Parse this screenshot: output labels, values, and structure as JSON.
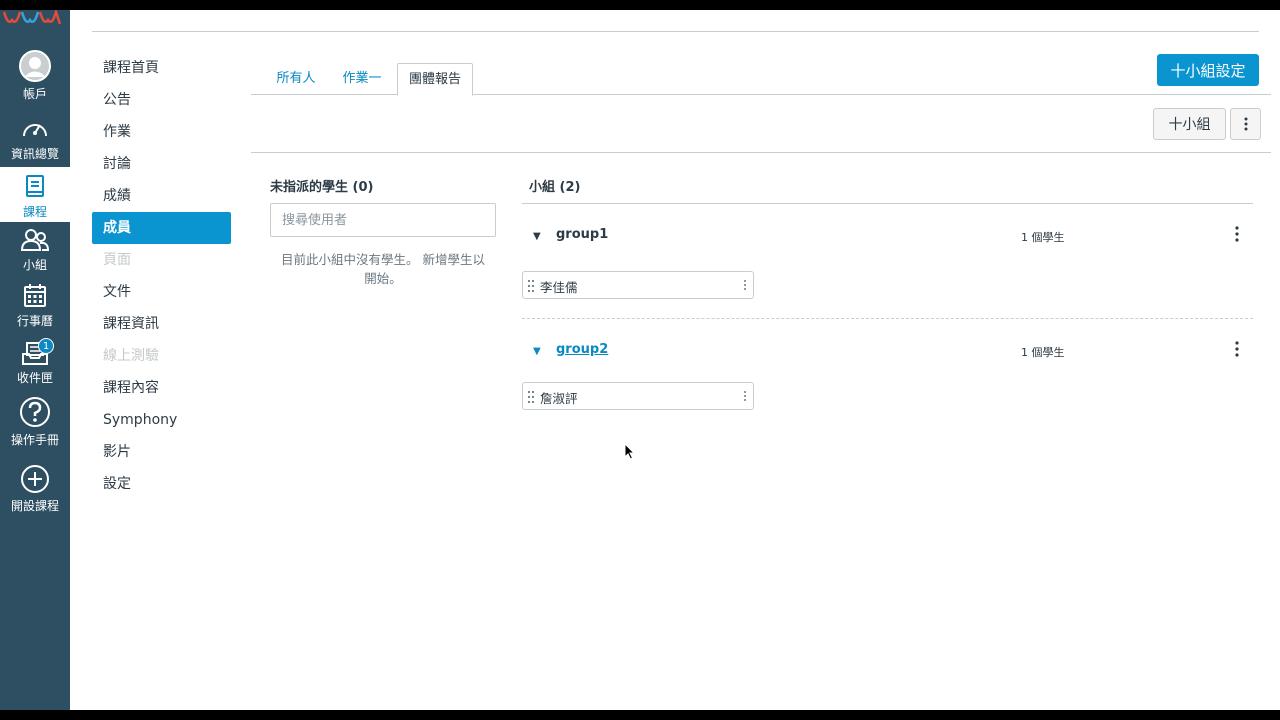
{
  "global_nav": {
    "items": [
      {
        "label": "帳戶",
        "icon": "avatar-icon"
      },
      {
        "label": "資訊總覽",
        "icon": "dashboard-gauge-icon"
      },
      {
        "label": "課程",
        "icon": "course-book-icon",
        "active": true
      },
      {
        "label": "小組",
        "icon": "groups-people-icon"
      },
      {
        "label": "行事曆",
        "icon": "calendar-icon"
      },
      {
        "label": "收件匣",
        "icon": "inbox-icon",
        "badge": "1"
      },
      {
        "label": "操作手冊",
        "icon": "help-question-icon"
      },
      {
        "label": "開設課程",
        "icon": "add-circle-icon"
      }
    ]
  },
  "course_nav": {
    "items": [
      {
        "label": "課程首頁"
      },
      {
        "label": "公告"
      },
      {
        "label": "作業"
      },
      {
        "label": "討論"
      },
      {
        "label": "成績"
      },
      {
        "label": "成員",
        "active": true
      },
      {
        "label": "頁面",
        "disabled": true
      },
      {
        "label": "文件"
      },
      {
        "label": "課程資訊"
      },
      {
        "label": "線上測驗",
        "disabled": true
      },
      {
        "label": "課程內容"
      },
      {
        "label": "Symphony"
      },
      {
        "label": "影片"
      },
      {
        "label": "設定"
      }
    ]
  },
  "tabs": [
    {
      "label": "所有人"
    },
    {
      "label": "作業一"
    },
    {
      "label": "團體報告",
      "active": true
    }
  ],
  "toolbar": {
    "group_settings_label": "十小組設定",
    "add_group_label": "十小組"
  },
  "unassigned": {
    "title": "未指派的學生 (0)",
    "search_placeholder": "搜尋使用者",
    "empty_message": "目前此小組中沒有學生。 新增學生以開始。"
  },
  "groups_section": {
    "title": "小組 (2)",
    "groups": [
      {
        "name": "group1",
        "count": "1 個學生",
        "members": [
          "李佳儒"
        ]
      },
      {
        "name": "group2",
        "count": "1 個學生",
        "members": [
          "詹淑評"
        ]
      }
    ]
  },
  "colors": {
    "nav_bg": "#2e4f61",
    "accent": "#0a95d0",
    "link": "#0a89c2"
  }
}
